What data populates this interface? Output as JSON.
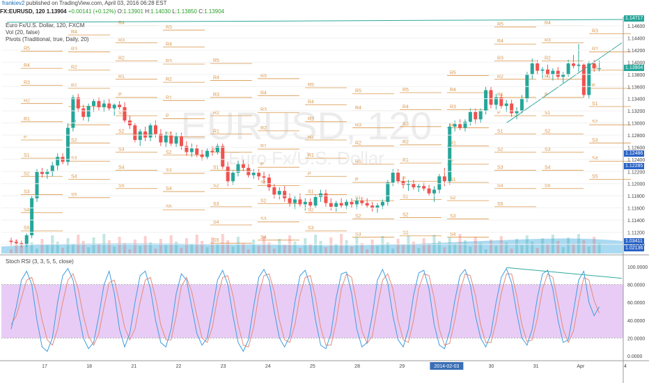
{
  "header": {
    "username": "frankiev2",
    "published": "published on TradingView.com, April 03, 2016 06:28 EST"
  },
  "quote": {
    "symbol": "FX:EURUSD, 120",
    "last": "1.13904",
    "change": "+0.00141 (+0.12%)",
    "open_label": "O:",
    "open": "1.13901",
    "high_label": "H:",
    "high": "1.14030",
    "low_label": "L:",
    "low": "1.13850",
    "close_label": "C:",
    "close": "1.13904"
  },
  "legend": {
    "title": "Euro Fx/U.S. Dollar, 120, FXCM",
    "volume": "Vol (20, false)",
    "pivots": "Pivots (Traditional, true, Daily, 20)",
    "stoch": "Stoch RSI (3, 3, 5, 5, close)"
  },
  "watermark": {
    "symbol": "EURUSD, 120",
    "name": "Euro Fx/U.S. Dollar"
  },
  "price_axis": {
    "ticks": [
      "1.14600",
      "1.14400",
      "1.14200",
      "1.14000",
      "1.13800",
      "1.13600",
      "1.13400",
      "1.13200",
      "1.13000",
      "1.12800",
      "1.12600",
      "1.12400",
      "1.12200",
      "1.12000",
      "1.11800",
      "1.11600",
      "1.11400",
      "1.11200",
      "1.11000"
    ],
    "tags": [
      {
        "text": "1.14717",
        "color": "#26a69a",
        "price": 1.14717
      },
      {
        "text": "1.13904",
        "color": "#26a69a",
        "price": 1.13904
      },
      {
        "text": "1.12486",
        "color": "#2a63c6",
        "price": 1.12486
      },
      {
        "text": "1.12285",
        "color": "#2a63c6",
        "price": 1.12285
      }
    ],
    "bottom_tags": [
      "1.03411",
      "1.02136"
    ]
  },
  "stoch_axis": {
    "ticks": [
      "100.0000",
      "80.0000",
      "60.0000",
      "40.0000",
      "20.0000",
      "0.0000"
    ]
  },
  "time_axis": {
    "labels": [
      "17",
      "18",
      "21",
      "22",
      "23",
      "24",
      "25",
      "28",
      "29",
      "2014-02-03",
      "30",
      "31",
      "Apr",
      "4"
    ],
    "highlight": "2014-02-03"
  },
  "pivot_labels": [
    "R5",
    "R4",
    "R3",
    "R2",
    "R1",
    "P",
    "S1",
    "S2",
    "S3",
    "S4",
    "S5"
  ],
  "colors": {
    "up": "#26a69a",
    "down": "#ef5350",
    "pivot": "#d9964a",
    "stoch_k": "#3d9de0",
    "stoch_d": "#e58a7a",
    "band": "#e6c6f4",
    "trend": "#2fa89a"
  },
  "chart_data": {
    "type": "candlestick",
    "price_range": [
      1.1085,
      1.1475
    ],
    "stoch_range": [
      0,
      100
    ],
    "candles": [
      [
        1.1106,
        1.1111,
        1.1098,
        1.1104
      ],
      [
        1.1104,
        1.1108,
        1.11,
        1.1102
      ],
      [
        1.1102,
        1.1106,
        1.1095,
        1.11
      ],
      [
        1.11,
        1.1118,
        1.1096,
        1.1115
      ],
      [
        1.1115,
        1.118,
        1.111,
        1.1176
      ],
      [
        1.1176,
        1.1224,
        1.117,
        1.122
      ],
      [
        1.122,
        1.1226,
        1.121,
        1.1216
      ],
      [
        1.1216,
        1.1224,
        1.1208,
        1.122
      ],
      [
        1.122,
        1.1236,
        1.1212,
        1.123
      ],
      [
        1.123,
        1.125,
        1.1222,
        1.1244
      ],
      [
        1.1244,
        1.125,
        1.1232,
        1.1236
      ],
      [
        1.1236,
        1.13,
        1.123,
        1.1292
      ],
      [
        1.1292,
        1.1346,
        1.1286,
        1.1342
      ],
      [
        1.1342,
        1.1348,
        1.1318,
        1.1324
      ],
      [
        1.1324,
        1.133,
        1.1304,
        1.131
      ],
      [
        1.131,
        1.1332,
        1.1302,
        1.1328
      ],
      [
        1.1328,
        1.134,
        1.1318,
        1.1336
      ],
      [
        1.1336,
        1.1342,
        1.132,
        1.1326
      ],
      [
        1.1326,
        1.1338,
        1.1318,
        1.1332
      ],
      [
        1.1332,
        1.134,
        1.132,
        1.1324
      ],
      [
        1.1324,
        1.1332,
        1.1312,
        1.133
      ],
      [
        1.133,
        1.1336,
        1.1322,
        1.1326
      ],
      [
        1.1326,
        1.1334,
        1.13,
        1.1304
      ],
      [
        1.1304,
        1.1312,
        1.129,
        1.1296
      ],
      [
        1.1296,
        1.13,
        1.1268,
        1.1272
      ],
      [
        1.1272,
        1.129,
        1.1262,
        1.1286
      ],
      [
        1.1286,
        1.1294,
        1.127,
        1.1276
      ],
      [
        1.1276,
        1.13,
        1.127,
        1.1296
      ],
      [
        1.1296,
        1.1304,
        1.1276,
        1.1282
      ],
      [
        1.1282,
        1.129,
        1.1262,
        1.1268
      ],
      [
        1.1268,
        1.1286,
        1.126,
        1.128
      ],
      [
        1.128,
        1.1286,
        1.1262,
        1.1266
      ],
      [
        1.1266,
        1.1284,
        1.126,
        1.1278
      ],
      [
        1.1278,
        1.1284,
        1.1256,
        1.1262
      ],
      [
        1.1262,
        1.127,
        1.1246,
        1.1252
      ],
      [
        1.1252,
        1.1266,
        1.1244,
        1.1258
      ],
      [
        1.1258,
        1.1264,
        1.1244,
        1.1248
      ],
      [
        1.1248,
        1.1256,
        1.1238,
        1.1244
      ],
      [
        1.1244,
        1.1258,
        1.124,
        1.1254
      ],
      [
        1.1254,
        1.1262,
        1.1246,
        1.1252
      ],
      [
        1.1252,
        1.1266,
        1.1248,
        1.1262
      ],
      [
        1.1262,
        1.1266,
        1.1224,
        1.1228
      ],
      [
        1.1228,
        1.1236,
        1.1196,
        1.1204
      ],
      [
        1.1204,
        1.1222,
        1.1198,
        1.1218
      ],
      [
        1.1218,
        1.1238,
        1.1212,
        1.1232
      ],
      [
        1.1232,
        1.124,
        1.122,
        1.1226
      ],
      [
        1.1226,
        1.1232,
        1.121,
        1.1214
      ],
      [
        1.1214,
        1.1224,
        1.1208,
        1.1218
      ],
      [
        1.1218,
        1.1224,
        1.1206,
        1.1212
      ],
      [
        1.1212,
        1.122,
        1.12,
        1.121
      ],
      [
        1.121,
        1.1216,
        1.1188,
        1.1194
      ],
      [
        1.1194,
        1.12,
        1.1176,
        1.1182
      ],
      [
        1.1182,
        1.1194,
        1.1174,
        1.1188
      ],
      [
        1.1188,
        1.1196,
        1.117,
        1.1176
      ],
      [
        1.1176,
        1.1184,
        1.1162,
        1.1168
      ],
      [
        1.1168,
        1.118,
        1.1158,
        1.1174
      ],
      [
        1.1174,
        1.1184,
        1.1162,
        1.1166
      ],
      [
        1.1166,
        1.1176,
        1.1156,
        1.117
      ],
      [
        1.117,
        1.1176,
        1.1158,
        1.1164
      ],
      [
        1.1164,
        1.1182,
        1.116,
        1.1178
      ],
      [
        1.1178,
        1.119,
        1.117,
        1.1184
      ],
      [
        1.1184,
        1.119,
        1.1162,
        1.1168
      ],
      [
        1.1168,
        1.1176,
        1.1156,
        1.1162
      ],
      [
        1.1162,
        1.1172,
        1.1154,
        1.1168
      ],
      [
        1.1168,
        1.1176,
        1.116,
        1.1164
      ],
      [
        1.1164,
        1.1174,
        1.1158,
        1.117
      ],
      [
        1.117,
        1.1176,
        1.116,
        1.1166
      ],
      [
        1.1166,
        1.1176,
        1.1158,
        1.1172
      ],
      [
        1.1172,
        1.1178,
        1.1164,
        1.1168
      ],
      [
        1.1168,
        1.1176,
        1.116,
        1.1164
      ],
      [
        1.1164,
        1.117,
        1.1154,
        1.116
      ],
      [
        1.116,
        1.1168,
        1.1152,
        1.1164
      ],
      [
        1.1164,
        1.1174,
        1.1158,
        1.117
      ],
      [
        1.117,
        1.1206,
        1.1164,
        1.1202
      ],
      [
        1.1202,
        1.1224,
        1.1196,
        1.1218
      ],
      [
        1.1218,
        1.1224,
        1.12,
        1.1204
      ],
      [
        1.1204,
        1.1212,
        1.1192,
        1.1198
      ],
      [
        1.1198,
        1.1206,
        1.1188,
        1.12
      ],
      [
        1.12,
        1.1206,
        1.119,
        1.1194
      ],
      [
        1.1194,
        1.12,
        1.1186,
        1.1196
      ],
      [
        1.1196,
        1.1202,
        1.1188,
        1.1192
      ],
      [
        1.1192,
        1.1198,
        1.118,
        1.1184
      ],
      [
        1.1184,
        1.1196,
        1.117,
        1.119
      ],
      [
        1.119,
        1.1216,
        1.1184,
        1.1212
      ],
      [
        1.1212,
        1.1226,
        1.1196,
        1.1204
      ],
      [
        1.1204,
        1.13,
        1.1198,
        1.1294
      ],
      [
        1.1294,
        1.1304,
        1.1286,
        1.1298
      ],
      [
        1.1298,
        1.1306,
        1.1288,
        1.1292
      ],
      [
        1.1292,
        1.1306,
        1.1286,
        1.1302
      ],
      [
        1.1302,
        1.1324,
        1.1296,
        1.1318
      ],
      [
        1.1318,
        1.1324,
        1.1298,
        1.1306
      ],
      [
        1.1306,
        1.1324,
        1.13,
        1.132
      ],
      [
        1.132,
        1.136,
        1.1314,
        1.1354
      ],
      [
        1.1354,
        1.136,
        1.1324,
        1.133
      ],
      [
        1.133,
        1.1348,
        1.1322,
        1.1342
      ],
      [
        1.1342,
        1.1348,
        1.1324,
        1.1328
      ],
      [
        1.1328,
        1.1338,
        1.1318,
        1.1332
      ],
      [
        1.1332,
        1.1338,
        1.131,
        1.1316
      ],
      [
        1.1316,
        1.1326,
        1.1306,
        1.132
      ],
      [
        1.132,
        1.1346,
        1.1316,
        1.134
      ],
      [
        1.134,
        1.1384,
        1.1334,
        1.138
      ],
      [
        1.138,
        1.1406,
        1.1372,
        1.1398
      ],
      [
        1.1398,
        1.1404,
        1.138,
        1.1386
      ],
      [
        1.1386,
        1.1392,
        1.1374,
        1.1388
      ],
      [
        1.1388,
        1.1396,
        1.1376,
        1.138
      ],
      [
        1.138,
        1.139,
        1.137,
        1.1386
      ],
      [
        1.1386,
        1.1392,
        1.1372,
        1.1376
      ],
      [
        1.1376,
        1.1384,
        1.1366,
        1.138
      ],
      [
        1.138,
        1.1404,
        1.1376,
        1.1398
      ],
      [
        1.1398,
        1.1412,
        1.139,
        1.1394
      ],
      [
        1.1394,
        1.143,
        1.1384,
        1.1396
      ],
      [
        1.1396,
        1.1398,
        1.1342,
        1.1346
      ],
      [
        1.1346,
        1.1402,
        1.134,
        1.1398
      ],
      [
        1.1398,
        1.1404,
        1.1384,
        1.139
      ],
      [
        1.139,
        1.1403,
        1.1385,
        1.139
      ]
    ],
    "stoch_k": [
      30,
      55,
      85,
      95,
      80,
      40,
      10,
      5,
      20,
      60,
      90,
      98,
      85,
      50,
      20,
      8,
      15,
      45,
      80,
      95,
      70,
      30,
      10,
      25,
      60,
      90,
      95,
      75,
      40,
      15,
      10,
      30,
      70,
      92,
      85,
      55,
      25,
      12,
      20,
      50,
      85,
      96,
      80,
      45,
      15,
      5,
      18,
      55,
      88,
      97,
      85,
      50,
      20,
      10,
      22,
      60,
      90,
      96,
      78,
      40,
      12,
      8,
      25,
      65,
      92,
      94,
      70,
      30,
      10,
      15,
      45,
      85,
      97,
      82,
      45,
      18,
      10,
      30,
      68,
      93,
      96,
      75,
      35,
      12,
      8,
      28,
      62,
      90,
      97,
      80,
      45,
      20,
      10,
      25,
      60,
      88,
      98,
      82,
      48,
      20,
      12,
      30,
      65,
      92,
      96,
      75,
      40,
      15,
      18,
      50,
      85,
      95,
      60,
      45,
      55
    ],
    "stoch_d": [
      35,
      45,
      65,
      85,
      88,
      70,
      40,
      18,
      12,
      30,
      60,
      85,
      92,
      75,
      45,
      22,
      12,
      25,
      55,
      82,
      85,
      60,
      32,
      18,
      30,
      60,
      85,
      88,
      65,
      35,
      18,
      18,
      45,
      78,
      88,
      72,
      45,
      20,
      15,
      32,
      65,
      88,
      90,
      68,
      35,
      12,
      10,
      32,
      68,
      90,
      92,
      72,
      40,
      18,
      15,
      35,
      68,
      88,
      90,
      65,
      32,
      12,
      12,
      38,
      75,
      92,
      88,
      58,
      28,
      14,
      22,
      55,
      85,
      92,
      75,
      40,
      18,
      15,
      40,
      75,
      92,
      90,
      65,
      30,
      12,
      14,
      40,
      72,
      92,
      90,
      68,
      35,
      15,
      15,
      38,
      70,
      92,
      92,
      68,
      35,
      16,
      18,
      42,
      75,
      92,
      88,
      60,
      30,
      15,
      28,
      60,
      88,
      85,
      62,
      48
    ]
  }
}
